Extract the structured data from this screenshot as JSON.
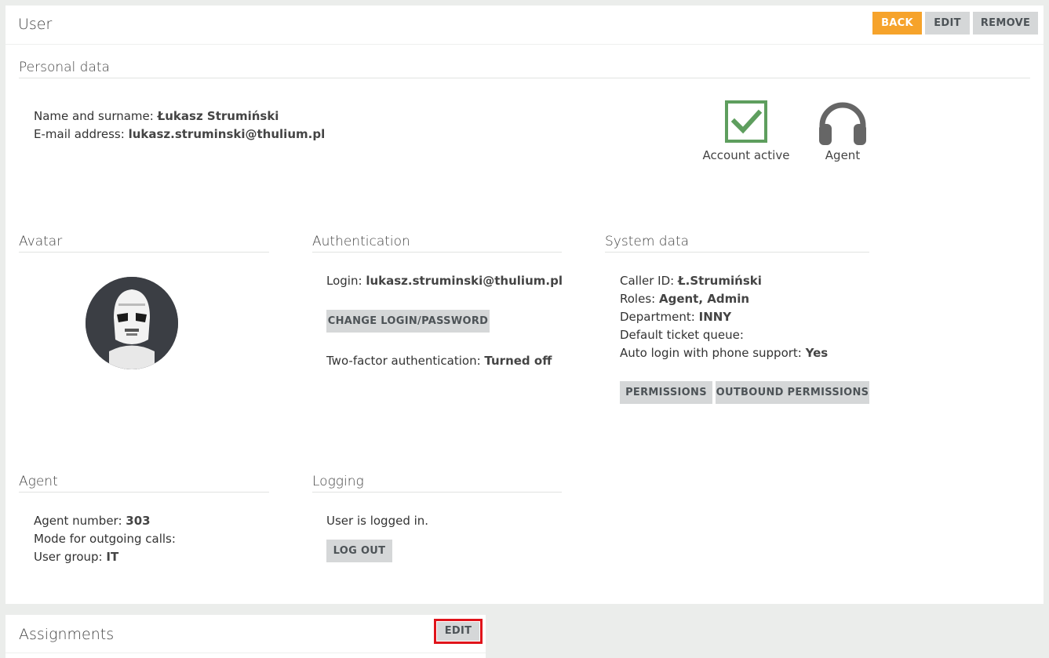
{
  "header": {
    "title": "User",
    "back_label": "BACK",
    "edit_label": "EDIT",
    "remove_label": "REMOVE"
  },
  "personal": {
    "title": "Personal data",
    "name_label": "Name and surname:",
    "name_value": "Łukasz Strumiński",
    "email_label": "E-mail address:",
    "email_value": "lukasz.struminski@thulium.pl",
    "account_active_label": "Account active",
    "agent_label": "Agent"
  },
  "avatar": {
    "title": "Avatar"
  },
  "authentication": {
    "title": "Authentication",
    "login_label": "Login:",
    "login_value": "lukasz.struminski@thulium.pl",
    "change_button": "CHANGE LOGIN/PASSWORD",
    "twofa_label": "Two-factor authentication:",
    "twofa_value": "Turned off"
  },
  "system": {
    "title": "System data",
    "caller_id_label": "Caller ID:",
    "caller_id_value": "Ł.Strumiński",
    "roles_label": "Roles:",
    "roles_value": "Agent, Admin",
    "department_label": "Department:",
    "department_value": "INNY",
    "queue_label": "Default ticket queue:",
    "queue_value": "",
    "autologin_label": "Auto login with phone support:",
    "autologin_value": "Yes",
    "permissions_button": "PERMISSIONS",
    "outbound_button": "OUTBOUND PERMISSIONS"
  },
  "agent": {
    "title": "Agent",
    "number_label": "Agent number:",
    "number_value": "303",
    "mode_label": "Mode for outgoing calls:",
    "mode_value": "",
    "group_label": "User group:",
    "group_value": "IT"
  },
  "logging": {
    "title": "Logging",
    "status_text": "User is logged in.",
    "logout_button": "LOG OUT"
  },
  "assignments": {
    "title": "Assignments",
    "edit_label": "EDIT"
  },
  "colors": {
    "accent_orange": "#f6a32b",
    "check_green": "#5e9e5e",
    "highlight_red": "#e0141b"
  }
}
